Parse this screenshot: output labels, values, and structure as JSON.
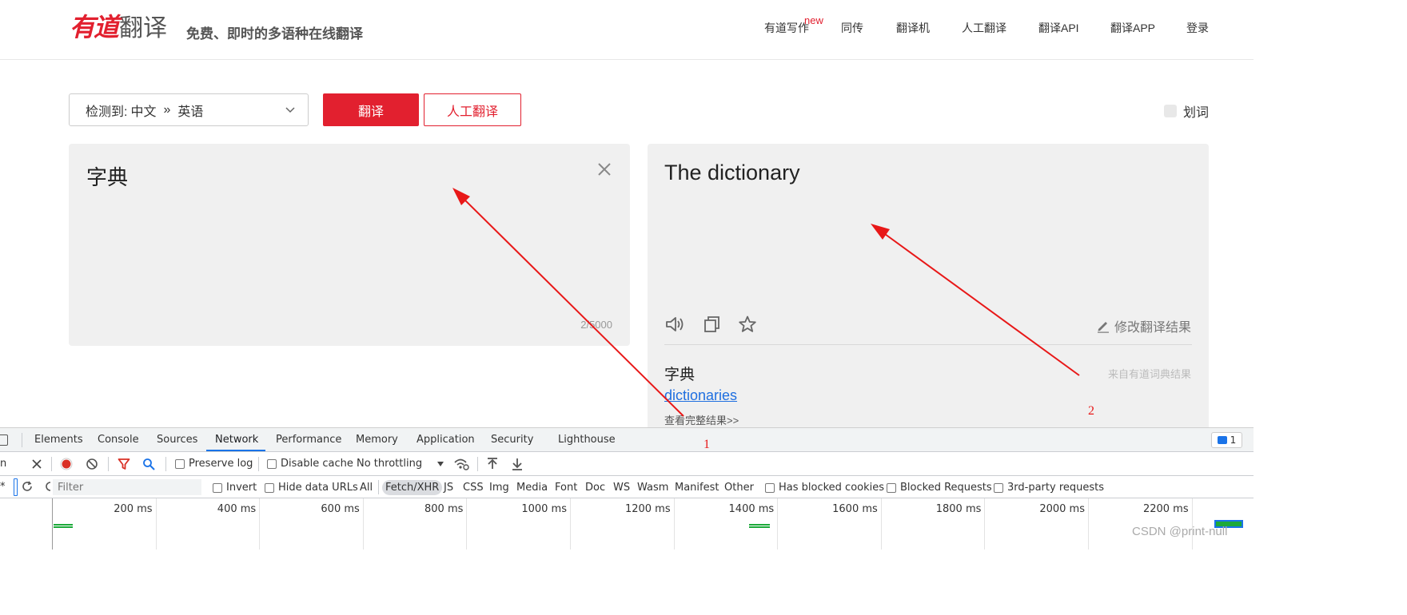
{
  "header": {
    "logo_red": "有道",
    "logo_gray": "翻译",
    "slogan": "免费、即时的多语种在线翻译",
    "nav": [
      "有道写作",
      "同传",
      "翻译机",
      "人工翻译",
      "翻译API",
      "翻译APP",
      "登录"
    ],
    "nav_badge": "new"
  },
  "toolbar": {
    "detect_label": "检测到:",
    "source_lang": "中文",
    "arrow": "»",
    "target_lang": "英语",
    "translate_button": "翻译",
    "human_button": "人工翻译",
    "huaci_label": "划词"
  },
  "input_panel": {
    "text": "字典",
    "counter": "2/5000"
  },
  "output_panel": {
    "text": "The dictionary",
    "edit_label": "修改翻译结果",
    "dict_word": "字典",
    "dict_source": "来自有道词典结果",
    "dict_link": "dictionaries",
    "dict_more": "查看完整结果>>"
  },
  "devtools": {
    "tabs": [
      "Elements",
      "Console",
      "Sources",
      "Network",
      "Performance",
      "Memory",
      "Application",
      "Security",
      "Lighthouse"
    ],
    "active_tab": "Network",
    "issues_count": "1",
    "toolbar": {
      "left_fragment": "n",
      "preserve_log": "Preserve log",
      "disable_cache": "Disable cache",
      "throttling": "No throttling"
    },
    "filter": {
      "placeholder": "Filter",
      "invert": "Invert",
      "hide_data_urls": "Hide data URLs",
      "types": [
        "All",
        "Fetch/XHR",
        "JS",
        "CSS",
        "Img",
        "Media",
        "Font",
        "Doc",
        "WS",
        "Wasm",
        "Manifest",
        "Other"
      ],
      "active_type": "Fetch/XHR",
      "has_blocked_cookies": "Has blocked cookies",
      "blocked_requests": "Blocked Requests",
      "third_party": "3rd-party requests"
    },
    "timeline_ticks": [
      "200 ms",
      "400 ms",
      "600 ms",
      "800 ms",
      "1000 ms",
      "1200 ms",
      "1400 ms",
      "1600 ms",
      "1800 ms",
      "2000 ms",
      "2200 ms"
    ]
  },
  "annotations": {
    "label_1": "1",
    "label_2": "2",
    "arrow_color": "#e81818"
  },
  "watermark": "CSDN @print-null",
  "colors": {
    "brand_red": "#e2202f",
    "link_blue": "#1f6fe0",
    "devtools_accent": "#1a73e8"
  }
}
